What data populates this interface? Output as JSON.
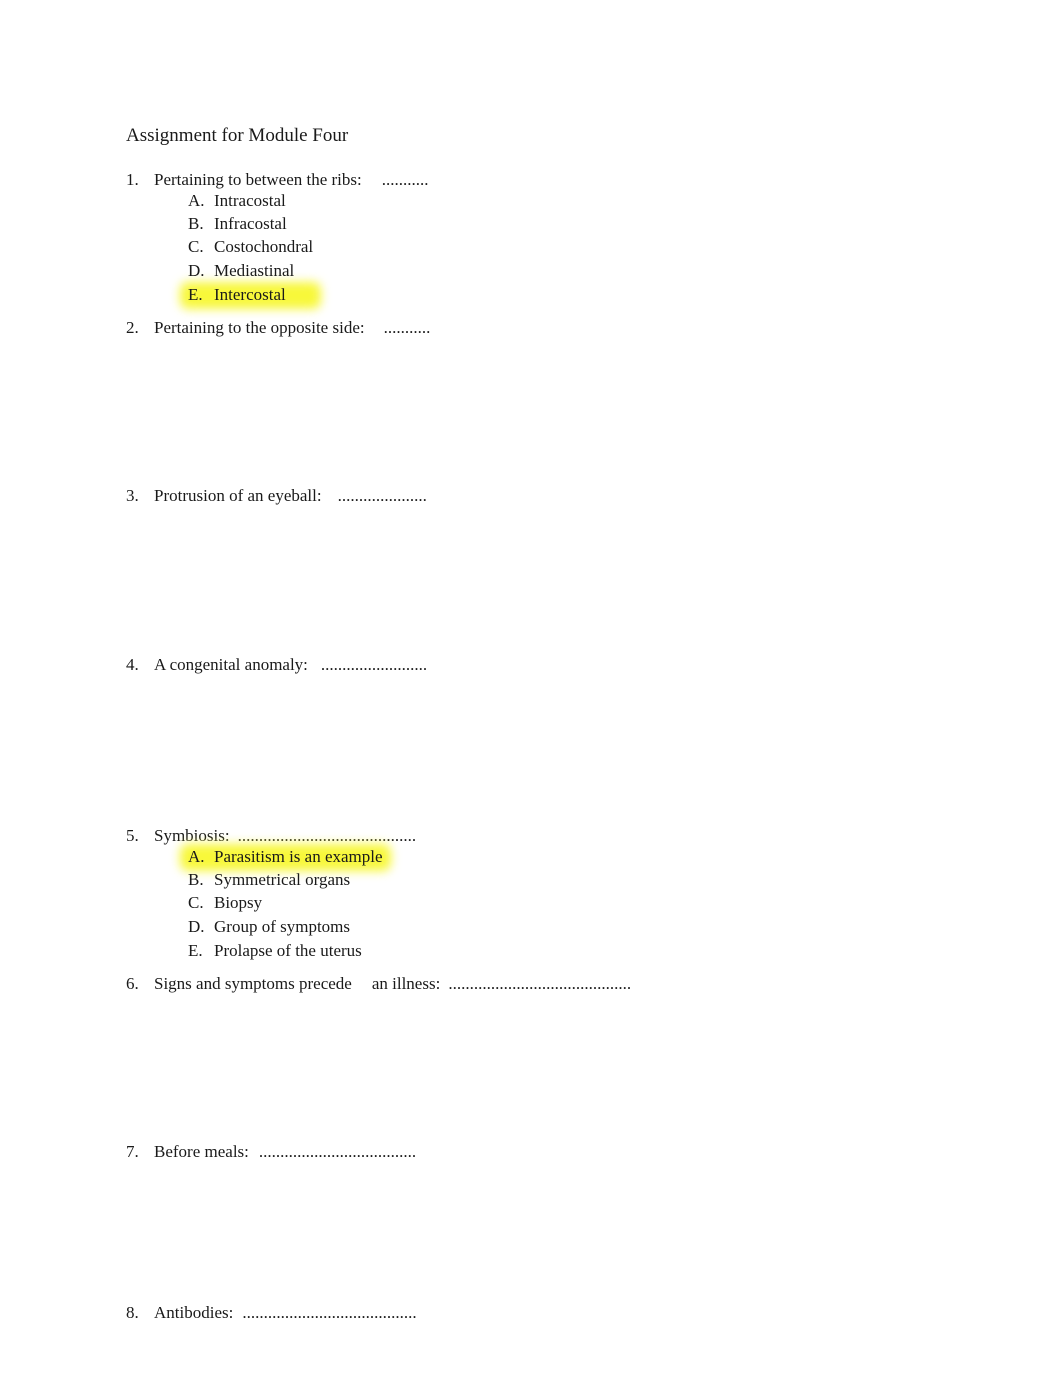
{
  "document": {
    "title": "Assignment for Module Four",
    "highlight_color": "#f8f83a",
    "questions": [
      {
        "number": "1.",
        "text": "Pertaining to between the ribs:",
        "blank": "...........",
        "options": [
          {
            "letter": "A.",
            "text": "Intracostal",
            "highlighted": false
          },
          {
            "letter": "B.",
            "text": "Infracostal",
            "highlighted": false
          },
          {
            "letter": "C.",
            "text": "Costochondral",
            "highlighted": false
          },
          {
            "letter": "D.",
            "text": "Mediastinal",
            "highlighted": false
          },
          {
            "letter": "E.",
            "text": "Intercostal",
            "highlighted": true
          }
        ]
      },
      {
        "number": "2.",
        "text": "Pertaining to the opposite side:",
        "blank": "..........."
      },
      {
        "number": "3.",
        "text": "Protrusion of an eyeball:",
        "blank": "....................."
      },
      {
        "number": "4.",
        "text": "A congenital anomaly:",
        "blank": "........................."
      },
      {
        "number": "5.",
        "text": "Symbiosis:",
        "blank": "..........................................",
        "options": [
          {
            "letter": "A.",
            "text": "Parasitism is an example",
            "highlighted": true
          },
          {
            "letter": "B.",
            "text": "Symmetrical organs",
            "highlighted": false
          },
          {
            "letter": "C.",
            "text": "Biopsy",
            "highlighted": false
          },
          {
            "letter": "D.",
            "text": "Group of symptoms",
            "highlighted": false
          },
          {
            "letter": "E.",
            "text": "Prolapse of the uterus",
            "highlighted": false
          }
        ]
      },
      {
        "number": "6.",
        "text": "Signs and symptoms precede",
        "text_after_gap": "an illness:",
        "blank": "..........................................."
      },
      {
        "number": "7.",
        "text": "Before meals:",
        "blank": "....................................."
      },
      {
        "number": "8.",
        "text": "Antibodies:",
        "blank": "........................................."
      }
    ]
  }
}
